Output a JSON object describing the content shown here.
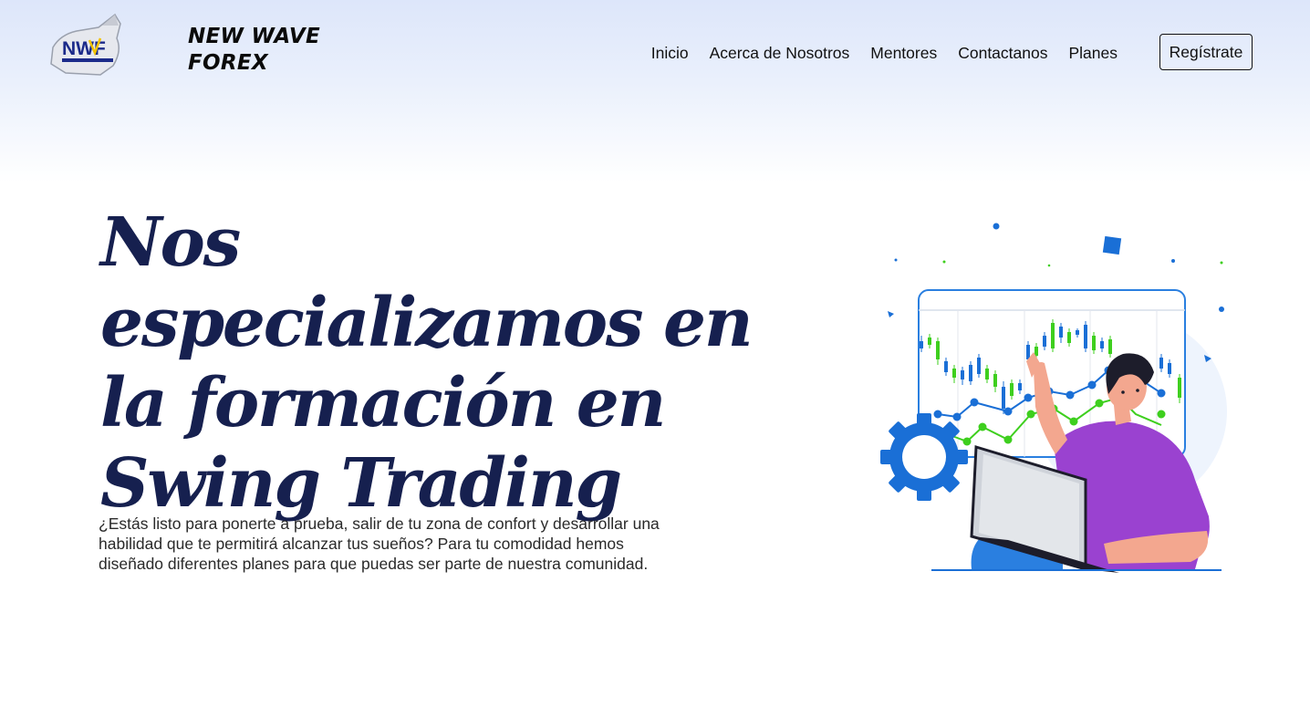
{
  "header": {
    "logo_text": "NWF",
    "brand_name": "NEW WAVE FOREX",
    "nav": [
      "Inicio",
      "Acerca de Nosotros",
      "Mentores",
      "Contactanos",
      "Planes"
    ],
    "register_label": "Regístrate"
  },
  "hero": {
    "title": "Nos especializamos en la formación en Swing Trading",
    "description": "¿Estás listo para ponerte a prueba, salir de tu zona de confort y desarrollar una habilidad que te permitirá alcanzar tus sueños? Para tu comodidad hemos diseñado diferentes planes para que puedas ser parte de nuestra comunidad."
  },
  "colors": {
    "title": "#16204f",
    "accent_blue": "#1a6fd6",
    "accent_green": "#3ecf1e",
    "accent_purple": "#9a42d0"
  }
}
